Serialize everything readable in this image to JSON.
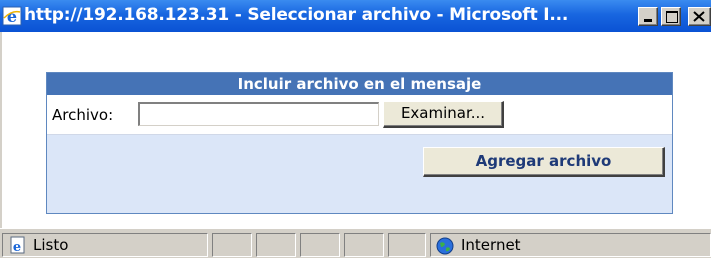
{
  "window": {
    "title": "http://192.168.123.31 - Seleccionar archivo - Microsoft I...",
    "icon": "ie-icon",
    "controls": [
      "minimize-icon",
      "maximize-icon",
      "close-icon"
    ]
  },
  "form": {
    "header": "Incluir archivo en el mensaje",
    "file_label": "Archivo:",
    "file_value": "",
    "browse_label": "Examinar...",
    "submit_label": "Agregar archivo"
  },
  "statusbar": {
    "status_text": "Listo",
    "zone_text": "Internet",
    "status_icon": "page-icon",
    "zone_icon": "globe-icon"
  },
  "colors": {
    "titlebar": "#0a52d4",
    "panel_header": "#4573b6",
    "panel_background": "#dbe6f8",
    "submit_text": "#1e3a78"
  }
}
